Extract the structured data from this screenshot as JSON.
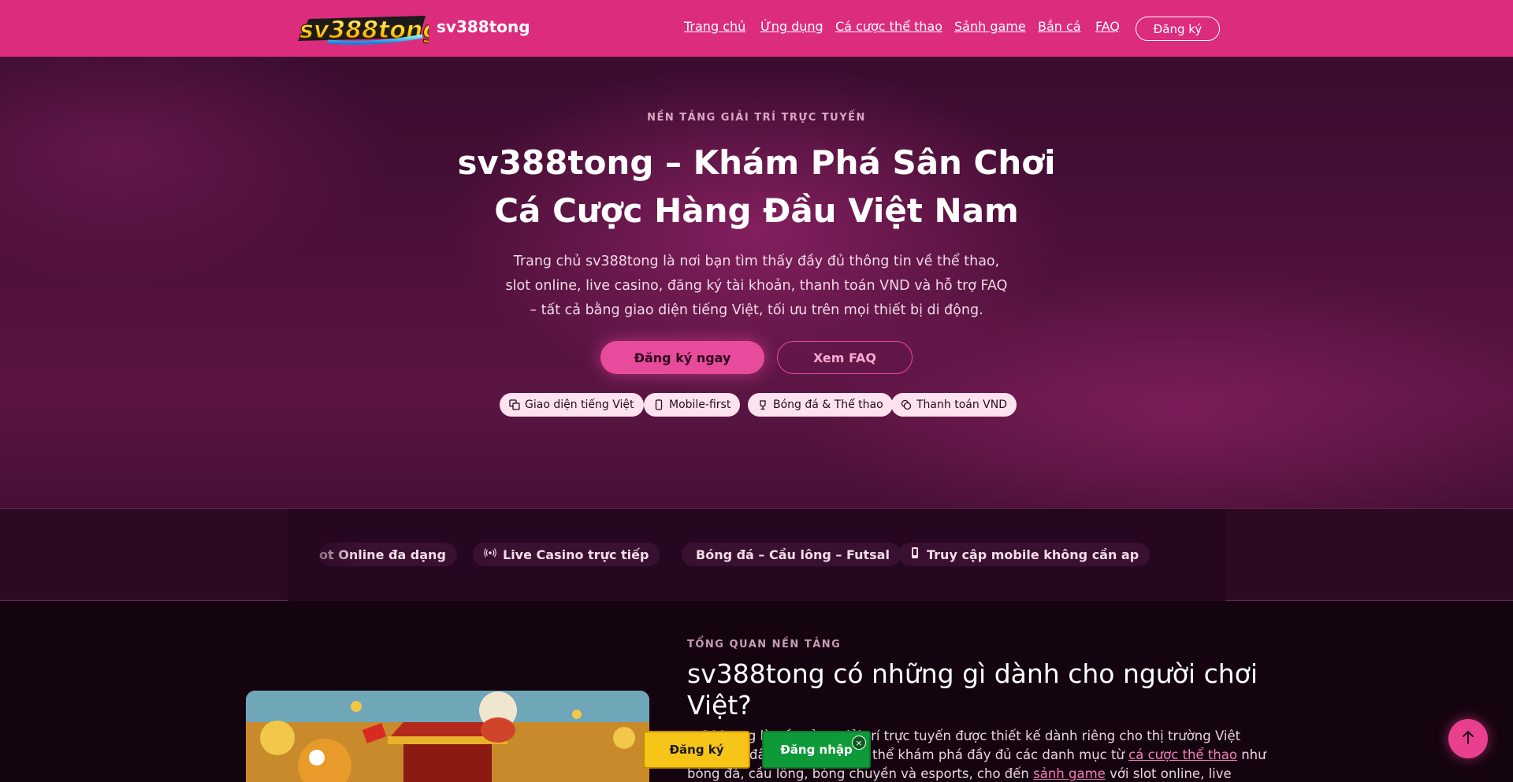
{
  "header": {
    "logo_text": "sv388tong",
    "brand": "sv388tong",
    "nav": [
      "Trang chủ",
      "Ứng dụng",
      "Cá cược thể thao",
      "Sảnh game",
      "Bắn cá",
      "FAQ"
    ],
    "register_label": "Đăng ký"
  },
  "hero": {
    "eyebrow": "NỀN TẢNG GIẢI TRÍ TRỰC TUYẾN",
    "title_line1": "sv388tong – Khám Phá Sân Chơi",
    "title_line2": "Cá Cược Hàng Đầu Việt Nam",
    "description": "Trang chủ sv388tong là nơi bạn tìm thấy đầy đủ thông tin về thể thao, slot online, live casino, đăng ký tài khoản, thanh toán VND và hỗ trợ FAQ – tất cả bằng giao diện tiếng Việt, tối ưu trên mọi thiết bị di động.",
    "cta_primary": "Đăng ký ngay",
    "cta_secondary": "Xem FAQ",
    "chips": [
      {
        "label": "Giao diện tiếng Việt",
        "icon": "translate-icon"
      },
      {
        "label": "Mobile-first",
        "icon": "mobile-icon"
      },
      {
        "label": "Bóng đá & Thể thao",
        "icon": "trophy-icon"
      },
      {
        "label": "Thanh toán VND",
        "icon": "coins-icon"
      }
    ]
  },
  "ticker": {
    "items": [
      {
        "label": "ot Online đa dạng",
        "icon": ""
      },
      {
        "label": "Live Casino trực tiếp",
        "icon": "broadcast-icon"
      },
      {
        "label": "Bóng đá – Cầu lông – Futsal",
        "icon": ""
      },
      {
        "label": "Truy cập mobile không cần ap",
        "icon": "mobile-icon"
      }
    ]
  },
  "overview": {
    "eyebrow": "TỔNG QUAN NỀN TẢNG",
    "title": "sv388tong có những gì dành cho người chơi Việt?",
    "text_start": "sv388tong là nền tảng giải trí trực tuyến được thiết kế dành riêng cho thị trường Việt Nam. Tại đây, người chơi có thể khám phá đầy đủ các danh mục từ ",
    "link1": "cá cược thể thao",
    "text_mid": " như bóng đá, cầu lông, bóng chuyền và esports, cho đến ",
    "link2": "sảnh game",
    "text_end": " với slot online, live casino và các trò chơi giải"
  },
  "floating": {
    "register": "Đăng ký",
    "login": "Đăng nhập",
    "close": "×"
  },
  "colors": {
    "header_bg": "#dc2c7e",
    "accent": "#e84a9c",
    "register_yellow": "#f6c518",
    "login_green": "#0f9a3a"
  }
}
